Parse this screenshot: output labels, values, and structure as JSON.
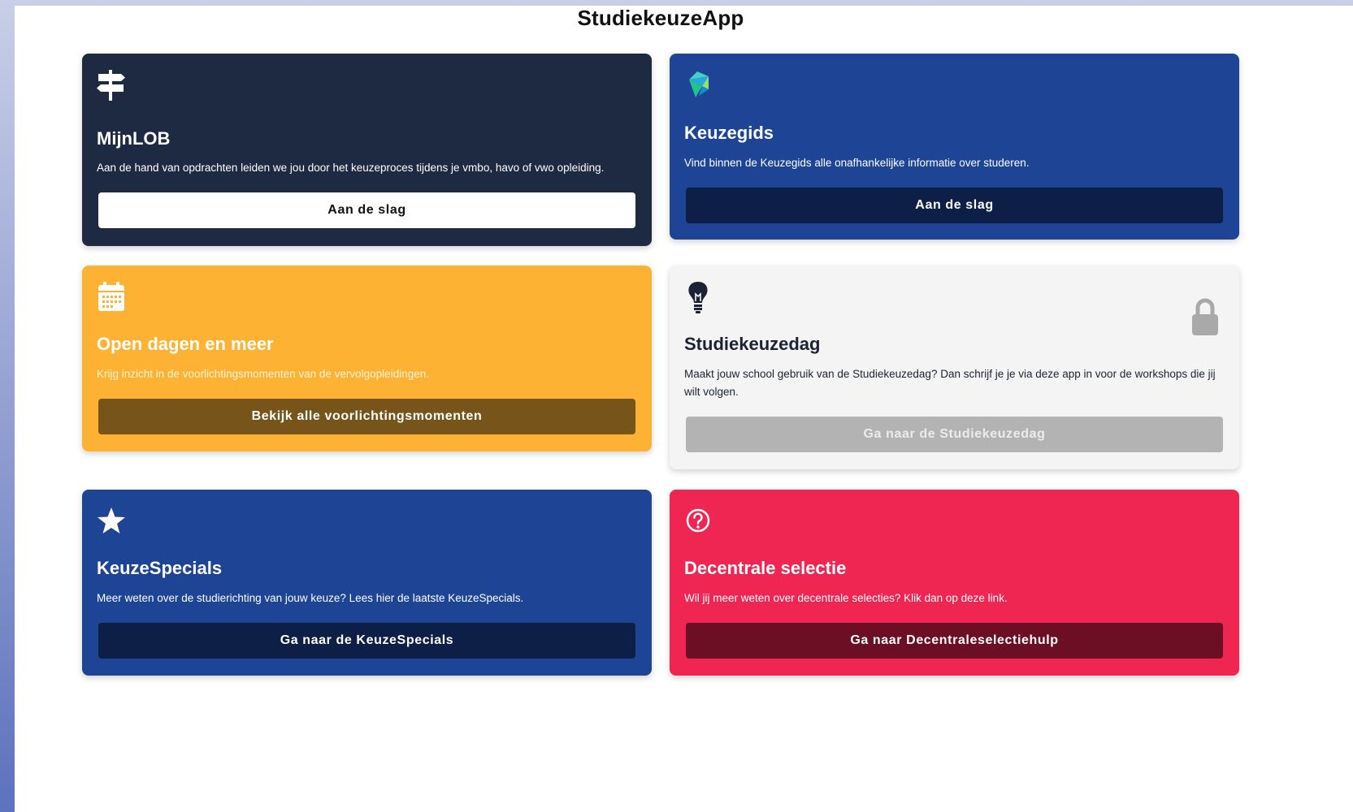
{
  "app": {
    "title": "StudiekeuzeApp"
  },
  "cards": [
    {
      "title": "MijnLOB",
      "description": "Aan de hand van opdrachten leiden we jou door het keuzeproces tijdens je vmbo, havo of vwo opleiding.",
      "button": "Aan de slag",
      "icon": "signpost-icon",
      "color": "#1e2942"
    },
    {
      "title": "Keuzegids",
      "description": "Vind binnen de Keuzegids alle onafhankelijke informatie over studeren.",
      "button": "Aan de slag",
      "icon": "keuzegids-logo-icon",
      "color": "#1e4496"
    },
    {
      "title": "Open dagen en meer",
      "description": "Krijg inzicht in de voorlichtingsmomenten van de vervolgopleidingen.",
      "button": "Bekijk alle voorlichtingsmomenten",
      "icon": "calendar-icon",
      "color": "#fdb233"
    },
    {
      "title": "Studiekeuzedag",
      "description": "Maakt jouw school gebruik van de Studiekeuzedag? Dan schrijf je je via deze app in voor de workshops die jij wilt volgen.",
      "button": "Ga naar de Studiekeuzedag",
      "icon": "lightbulb-icon",
      "locked": true,
      "color": "#f4f4f4"
    },
    {
      "title": "KeuzeSpecials",
      "description": "Meer weten over de studierichting van jouw keuze? Lees hier de laatste KeuzeSpecials.",
      "button": "Ga naar de KeuzeSpecials",
      "icon": "star-icon",
      "color": "#1e4496"
    },
    {
      "title": "Decentrale selectie",
      "description": "Wil jij meer weten over decentrale selecties? Klik dan op deze link.",
      "button": "Ga naar Decentraleselectiehulp",
      "icon": "question-circle-icon",
      "color": "#ef2552"
    }
  ]
}
